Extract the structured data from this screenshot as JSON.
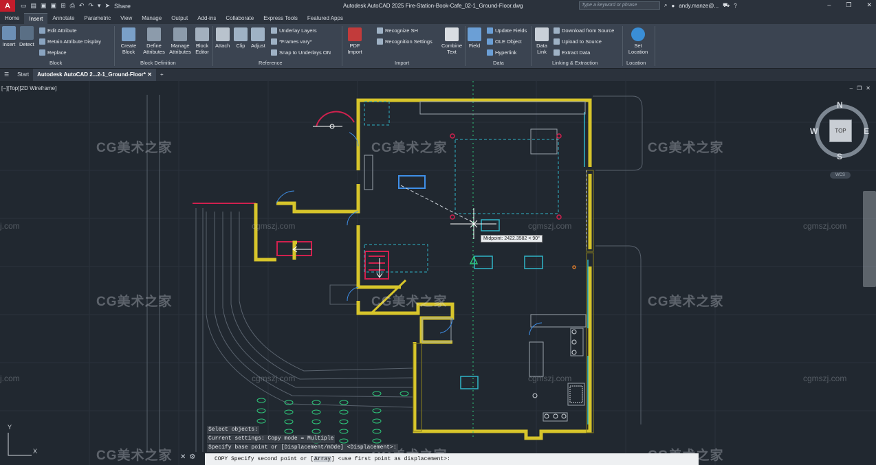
{
  "titlebar": {
    "logo": "A",
    "share": "Share",
    "doc_title": "Autodesk AutoCAD 2025  Fire-Station-Book-Cafe_02-1_Ground-Floor.dwg",
    "search_placeholder": "Type a keyword or phrase",
    "user": "andy.manze@..."
  },
  "ribbon_tabs": [
    "Home",
    "Insert",
    "Annotate",
    "Parametric",
    "View",
    "Manage",
    "Output",
    "Add-ins",
    "Collaborate",
    "Express Tools",
    "Featured Apps"
  ],
  "active_tab": "Insert",
  "ribbon": {
    "block": {
      "caption": "Block",
      "insert": "Insert",
      "detect": "Detect",
      "edit_attribute": "Edit Attribute",
      "retain_attr": "Retain Attribute Display",
      "replace": "Replace"
    },
    "block_def": {
      "caption": "Block Definition",
      "create": "Create Block",
      "define": "Define Attributes",
      "manage": "Manage Attributes",
      "editor": "Block Editor"
    },
    "reference": {
      "caption": "Reference",
      "attach": "Attach",
      "clip": "Clip",
      "adjust": "Adjust",
      "underlay_layers": "Underlay Layers",
      "frames": "*Frames vary*",
      "snap": "Snap to Underlays ON"
    },
    "import": {
      "caption": "Import",
      "pdf": "PDF Import",
      "recognize": "Recognize SH",
      "recog_settings": "Recognition Settings",
      "combine": "Combine Text"
    },
    "data": {
      "caption": "Data",
      "field": "Field",
      "update_fields": "Update Fields",
      "ole": "OLE Object",
      "hyperlink": "Hyperlink"
    },
    "linking": {
      "caption": "Linking & Extraction",
      "data_link": "Data Link",
      "download": "Download from Source",
      "upload": "Upload to Source",
      "extract": "Extract  Data"
    },
    "location": {
      "caption": "Location",
      "set_location": "Set Location"
    }
  },
  "file_tabs": {
    "start": "Start",
    "active": "Autodesk AutoCAD 2...2-1_Ground-Floor*"
  },
  "viewport": {
    "label": "[−][Top][2D Wireframe]",
    "tooltip": "Midpoint: 2422.3582 < 90°",
    "compass": {
      "n": "N",
      "s": "S",
      "e": "E",
      "w": "W",
      "top": "TOP",
      "wcs": "WCS"
    },
    "ucs": {
      "x": "X",
      "y": "Y"
    }
  },
  "watermark": {
    "cn": "CG美术之家",
    "url": "cgmszj.com",
    "partial": "j.com"
  },
  "command": {
    "history": [
      "Select objects:",
      "Current settings:  Copy mode = Multiple",
      "Specify base point or [Displacement/mOde] <Displacement>:"
    ],
    "prompt_cmd": "COPY",
    "prompt_a": " Specify second point or [",
    "prompt_kw": "Array",
    "prompt_b": "] <use first point as displacement>:"
  },
  "colors": {
    "wall": "#d7c52b",
    "red": "#d0214e",
    "cyan": "#30b5c8",
    "blue": "#3f8fe8",
    "green": "#2ec77a",
    "line": "#9aa3ad"
  }
}
